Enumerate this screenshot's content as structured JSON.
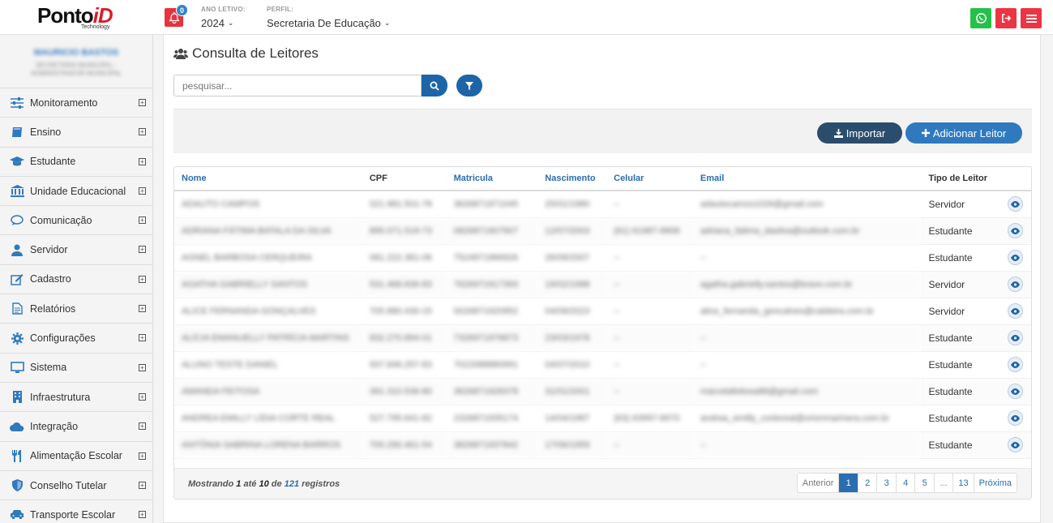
{
  "header": {
    "logo": "Ponto",
    "logo_accent": "iD",
    "logo_sub": "Technology",
    "notifications": "0",
    "year_label": "ANO LETIVO:",
    "year_value": "2024",
    "profile_label": "PERFIL:",
    "profile_value": "Secretaria De Educação"
  },
  "user": {
    "name": "MAURICIO BASTOS",
    "sub": "SECRETARIA MUNICIPAL - ADMINISTRADOR MUNICIPAL"
  },
  "sidebar": {
    "items": [
      {
        "label": "Monitoramento",
        "icon": "sliders-icon"
      },
      {
        "label": "Ensino",
        "icon": "book-icon"
      },
      {
        "label": "Estudante",
        "icon": "graduation-cap-icon"
      },
      {
        "label": "Unidade Educacional",
        "icon": "institution-icon"
      },
      {
        "label": "Comunicação",
        "icon": "chat-bubble-icon"
      },
      {
        "label": "Servidor",
        "icon": "user-icon"
      },
      {
        "label": "Cadastro",
        "icon": "edit-icon"
      },
      {
        "label": "Relatórios",
        "icon": "file-text-icon"
      },
      {
        "label": "Configurações",
        "icon": "gear-icon"
      },
      {
        "label": "Sistema",
        "icon": "monitor-icon"
      },
      {
        "label": "Infraestrutura",
        "icon": "building-icon"
      },
      {
        "label": "Integração",
        "icon": "cloud-icon"
      },
      {
        "label": "Alimentação Escolar",
        "icon": "cutlery-icon"
      },
      {
        "label": "Conselho Tutelar",
        "icon": "shield-icon"
      },
      {
        "label": "Transporte Escolar",
        "icon": "car-icon"
      }
    ]
  },
  "main": {
    "title": "Consulta de Leitores",
    "search_placeholder": "pesquisar...",
    "import_label": "Importar",
    "add_label": "Adicionar Leitor",
    "columns": [
      "Nome",
      "CPF",
      "Matricula",
      "Nascimento",
      "Celular",
      "Email",
      "Tipo de Leitor"
    ],
    "rows": [
      {
        "nome": "ADAUTO CAMPOS",
        "cpf": "021.981.501-78",
        "matricula": "3626871971045",
        "nascimento": "25/01/1980",
        "celular": "--",
        "email": "adautocamos1026@gmail.com",
        "tipo": "Servidor"
      },
      {
        "nome": "ADRIANA FÁTIMA BATALA DA SILVA",
        "cpf": "895.071.519-73",
        "matricula": "0826871907907",
        "nascimento": "12/07/2003",
        "celular": "(61) 61987-9908",
        "email": "adriana_fatima_dasilva@outlook.com.br",
        "tipo": "Estudante"
      },
      {
        "nome": "AGNEL BARBOSA CERQUEIRA",
        "cpf": "081.222.381-06",
        "matricula": "7524971966926",
        "nascimento": "26/09/2007",
        "celular": "--",
        "email": "--",
        "tipo": "Estudante"
      },
      {
        "nome": "AGATHA GABRIELLY SANTOS",
        "cpf": "531.468.836-83",
        "matricula": "7626971917393",
        "nascimento": "19/02/1998",
        "celular": "--",
        "email": "agatha.gabrielly.santos@bravo.com.br",
        "tipo": "Servidor"
      },
      {
        "nome": "ALICE FERNANDA GONÇALVES",
        "cpf": "705.880.430-15",
        "matricula": "0026871920952",
        "nascimento": "04/09/2023",
        "celular": "--",
        "email": "alice_fernanda_goncalves@caldeira.com.br",
        "tipo": "Servidor"
      },
      {
        "nome": "ALÍCIA EMANUELLY PATRÍCIA MARTINS",
        "cpf": "832.270.894-01",
        "matricula": "7326971976873",
        "nascimento": "23/03/1978",
        "celular": "--",
        "email": "--",
        "tipo": "Estudante"
      },
      {
        "nome": "ALUNO TESTE DANIEL",
        "cpf": "937.846.257-83",
        "matricula": "7022088880991",
        "nascimento": "04/07/2010",
        "celular": "--",
        "email": "--",
        "tipo": "Estudante"
      },
      {
        "nome": "AMANDA FEITOSA",
        "cpf": "391.310.536-80",
        "matricula": "3626871928378",
        "nascimento": "31/01/2001",
        "celular": "--",
        "email": "marcelafeitosa88@gmail.com",
        "tipo": "Estudante"
      },
      {
        "nome": "ANDREA EMILLY LÍDIA CORTE REAL",
        "cpf": "527.795.641-82",
        "matricula": "2326871935174",
        "nascimento": "14/04/1987",
        "celular": "(63) 63997-6670",
        "email": "andrea_emilly_cortereal@orionmarinera.com.br",
        "tipo": "Estudante"
      },
      {
        "nome": "ANTÔNIA SABRINA LORENA BARROS",
        "cpf": "700.290.461-54",
        "matricula": "3826871937842",
        "nascimento": "17/06/1959",
        "celular": "--",
        "email": "--",
        "tipo": "Estudante"
      }
    ],
    "info": {
      "prefix": "Mostrando",
      "from": "1",
      "mid": "até",
      "to": "10",
      "of": "de",
      "total": "121",
      "suffix": "registros"
    },
    "pagination": [
      "Anterior",
      "1",
      "2",
      "3",
      "4",
      "5",
      "...",
      "13",
      "Próxima"
    ],
    "active_page": "1"
  }
}
